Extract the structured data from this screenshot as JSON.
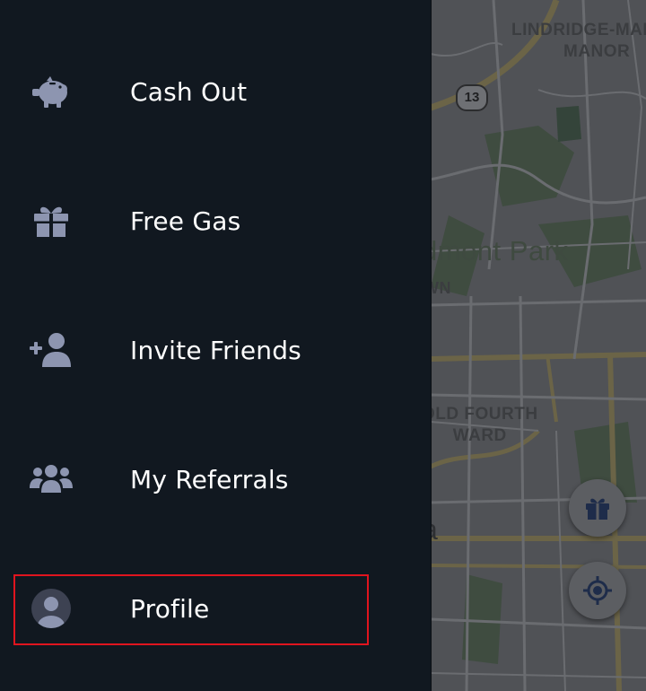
{
  "menu": {
    "items": [
      {
        "label": "Cash Out",
        "icon": "piggy-bank-icon"
      },
      {
        "label": "Free Gas",
        "icon": "gift-icon"
      },
      {
        "label": "Invite Friends",
        "icon": "add-user-icon"
      },
      {
        "label": "My Referrals",
        "icon": "users-group-icon"
      },
      {
        "label": "Profile",
        "icon": "user-circle-icon",
        "highlighted": true
      }
    ]
  },
  "map": {
    "labels": {
      "lindridge": "LINDRIDGE-MAR\nMANOR",
      "piedmont": "dmont Park",
      "town": "WN",
      "old_fourth": "OLD FOURTH\nWARD",
      "partial": "a"
    },
    "shield": "13"
  },
  "colors": {
    "drawer_bg": "#111820",
    "icon": "#8d95b0",
    "highlight_border": "#e0141e",
    "fab_icon": "#1e2c4a"
  }
}
